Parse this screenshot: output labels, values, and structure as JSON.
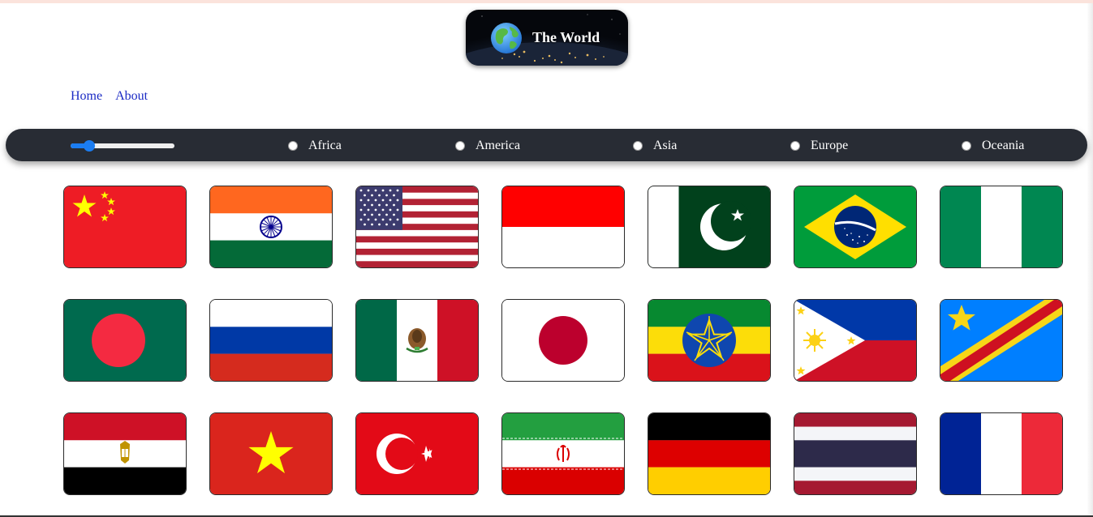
{
  "header": {
    "logo_title": "The World",
    "logo_icon": "globe-icon"
  },
  "nav": {
    "items": [
      "Home",
      "About"
    ]
  },
  "filters": {
    "slider_value_fraction": 0.13,
    "regions": [
      "Africa",
      "America",
      "Asia",
      "Europe",
      "Oceania"
    ],
    "selected_region": null
  },
  "flags": [
    "china",
    "india",
    "united-states",
    "indonesia",
    "pakistan",
    "brazil",
    "nigeria",
    "bangladesh",
    "russia",
    "mexico",
    "japan",
    "ethiopia",
    "philippines",
    "dr-congo",
    "egypt",
    "vietnam",
    "turkey",
    "iran",
    "germany",
    "thailand",
    "france"
  ],
  "colors": {
    "filterbar_bg": "#282c34",
    "nav_link": "#1a2ac4",
    "slider_accent": "#1b7df2"
  }
}
